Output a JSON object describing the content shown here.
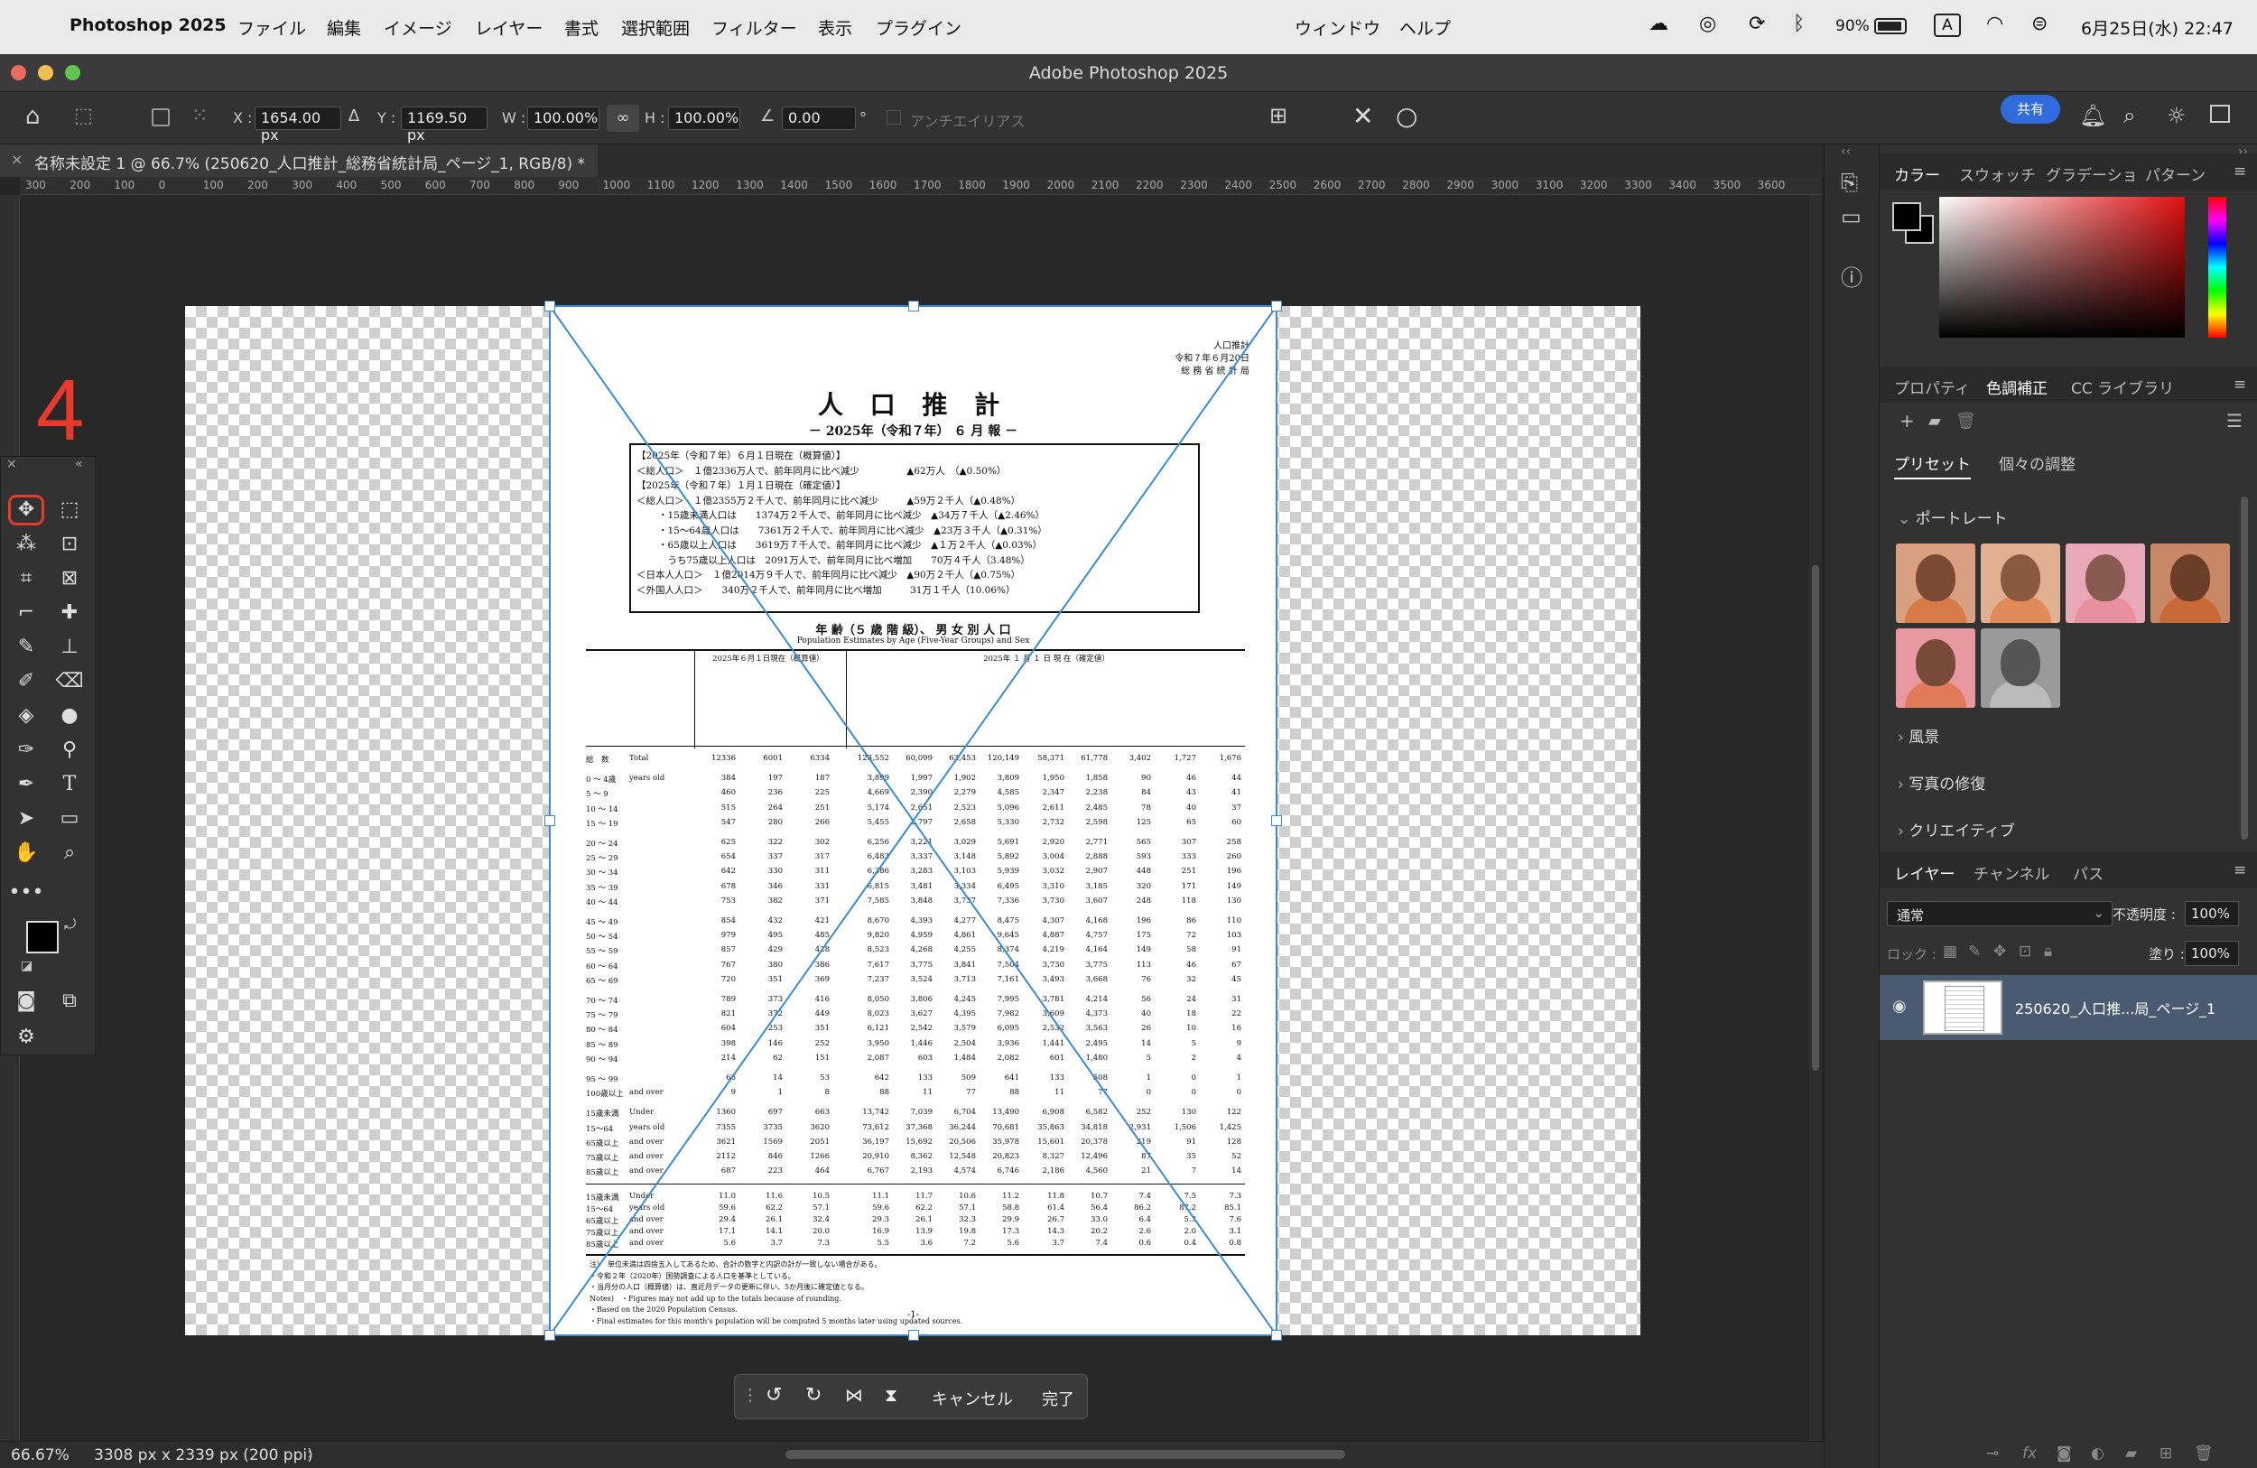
{
  "menubar": {
    "app_name": "Photoshop 2025",
    "items": [
      "ファイル",
      "編集",
      "イメージ",
      "レイヤー",
      "書式",
      "選択範囲",
      "フィルター",
      "表示",
      "プラグイン",
      "ウィンドウ",
      "ヘルプ"
    ],
    "battery": "90%",
    "input_mode": "A",
    "datetime": "6月25日(水)  22:47"
  },
  "window": {
    "title": "Adobe Photoshop 2025"
  },
  "options": {
    "x_label": "X :",
    "x_value": "1654.00 px",
    "y_label": "Y :",
    "y_value": "1169.50 px",
    "w_label": "W :",
    "w_value": "100.00%",
    "h_label": "H :",
    "h_value": "100.00%",
    "angle_value": "0.00",
    "angle_unit": "°",
    "antialias_label": "アンチエイリアス",
    "share_label": "共有"
  },
  "document_tab": {
    "title": "名称未設定 1 @ 66.7% (250620_人口推計_総務省統計局_ページ_1, RGB/8) *"
  },
  "ruler": {
    "ticks": [
      "300",
      "200",
      "100",
      "0",
      "100",
      "200",
      "300",
      "400",
      "500",
      "600",
      "700",
      "800",
      "900",
      "1000",
      "1100",
      "1200",
      "1300",
      "1400",
      "1500",
      "1600",
      "1700",
      "1800",
      "1900",
      "2000",
      "2100",
      "2200",
      "2300",
      "2400",
      "2500",
      "2600",
      "2700",
      "2800",
      "2900",
      "3000",
      "3100",
      "3200",
      "3300",
      "3400",
      "3500",
      "3600"
    ]
  },
  "annotation": {
    "step": "4"
  },
  "document": {
    "header_right": [
      "人口推計",
      "令和７年６月20日",
      "総 務 省 統 計 局"
    ],
    "title": "人 口 推 計",
    "subtitle": "－ 2025年（令和７年） ６ 月 報 －",
    "summary": [
      "【2025年（令和７年）６月１日現在（概算値）】",
      "＜総人口＞　１億2336万人で、前年同月に比べ減少　　　　　▲62万人　（▲0.50%）",
      "【2025年（令和７年）１月１日現在（確定値）】",
      "＜総人口＞　１億2355万２千人で、前年同月に比べ減少　　　▲59万２千人（▲0.48%）",
      "・15歳未満人口は　　1374万２千人で、前年同月に比べ減少　▲34万７千人（▲2.46%）",
      "・15～64歳人口は　　7361万２千人で、前年同月に比べ減少　▲23万３千人（▲0.31%）",
      "・65歳以上人口は　　3619万７千人で、前年同月に比べ減少　▲１万２千人（▲0.03%）",
      "　うち75歳以上人口は　2091万人で、前年同月に比べ増加　　70万４千人（3.48%）",
      "＜日本人人口＞　１億2014万９千人で、前年同月に比べ減少　▲90万２千人（▲0.75%）",
      "＜外国人人口＞　　340万２千人で、前年同月に比べ増加　　　31万１千人（10.06%）"
    ],
    "table_title": "年 齢（５ 歳 階 級）、 男 女 別 人 口",
    "table_subtitle": "Population Estimates by Age (Five-Year Groups) and Sex",
    "table_head_left": "2025年６月１日現在（概算値）",
    "table_head_right": "2025年 １ 月 １ 日 現 在（確定値）",
    "rows": [
      [
        "総　数",
        "Total",
        "12336",
        "6001",
        "6334",
        "123,552",
        "60,099",
        "63,453",
        "120,149",
        "58,371",
        "61,778",
        "3,402",
        "1,727",
        "1,676"
      ],
      [
        "0 ～ 4歳",
        "years old",
        "384",
        "197",
        "187",
        "3,899",
        "1,997",
        "1,902",
        "3,809",
        "1,950",
        "1,858",
        "90",
        "46",
        "44"
      ],
      [
        "5 ～ 9",
        "",
        "460",
        "236",
        "225",
        "4,669",
        "2,390",
        "2,279",
        "4,585",
        "2,347",
        "2,238",
        "84",
        "43",
        "41"
      ],
      [
        "10 ～ 14",
        "",
        "515",
        "264",
        "251",
        "5,174",
        "2,651",
        "2,523",
        "5,096",
        "2,611",
        "2,485",
        "78",
        "40",
        "37"
      ],
      [
        "15 ～ 19",
        "",
        "547",
        "280",
        "266",
        "5,455",
        "2,797",
        "2,658",
        "5,330",
        "2,732",
        "2,598",
        "125",
        "65",
        "60"
      ],
      [
        "20 ～ 24",
        "",
        "625",
        "322",
        "302",
        "6,256",
        "3,221",
        "3,029",
        "5,691",
        "2,920",
        "2,771",
        "565",
        "307",
        "258"
      ],
      [
        "25 ～ 29",
        "",
        "654",
        "337",
        "317",
        "6,483",
        "3,337",
        "3,148",
        "5,892",
        "3,004",
        "2,888",
        "593",
        "333",
        "260"
      ],
      [
        "30 ～ 34",
        "",
        "642",
        "330",
        "311",
        "6,386",
        "3,283",
        "3,103",
        "5,939",
        "3,032",
        "2,907",
        "448",
        "251",
        "196"
      ],
      [
        "35 ～ 39",
        "",
        "678",
        "346",
        "331",
        "6,815",
        "3,481",
        "3,334",
        "6,495",
        "3,310",
        "3,185",
        "320",
        "171",
        "149"
      ],
      [
        "40 ～ 44",
        "",
        "753",
        "382",
        "371",
        "7,585",
        "3,848",
        "3,737",
        "7,336",
        "3,730",
        "3,607",
        "248",
        "118",
        "130"
      ],
      [
        "45 ～ 49",
        "",
        "854",
        "432",
        "421",
        "8,670",
        "4,393",
        "4,277",
        "8,475",
        "4,307",
        "4,168",
        "196",
        "86",
        "110"
      ],
      [
        "50 ～ 54",
        "",
        "979",
        "495",
        "485",
        "9,820",
        "4,959",
        "4,861",
        "9,645",
        "4,887",
        "4,757",
        "175",
        "72",
        "103"
      ],
      [
        "55 ～ 59",
        "",
        "857",
        "429",
        "428",
        "8,523",
        "4,268",
        "4,255",
        "8,374",
        "4,219",
        "4,164",
        "149",
        "58",
        "91"
      ],
      [
        "60 ～ 64",
        "",
        "767",
        "380",
        "386",
        "7,617",
        "3,775",
        "3,841",
        "7,504",
        "3,730",
        "3,775",
        "113",
        "46",
        "67"
      ],
      [
        "65 ～ 69",
        "",
        "720",
        "351",
        "369",
        "7,237",
        "3,524",
        "3,713",
        "7,161",
        "3,493",
        "3,668",
        "76",
        "32",
        "45"
      ],
      [
        "70 ～ 74",
        "",
        "789",
        "373",
        "416",
        "8,050",
        "3,806",
        "4,245",
        "7,995",
        "3,781",
        "4,214",
        "56",
        "24",
        "31"
      ],
      [
        "75 ～ 79",
        "",
        "821",
        "372",
        "449",
        "8,023",
        "3,627",
        "4,395",
        "7,982",
        "3,609",
        "4,373",
        "40",
        "18",
        "22"
      ],
      [
        "80 ～ 84",
        "",
        "604",
        "253",
        "351",
        "6,121",
        "2,542",
        "3,579",
        "6,095",
        "2,532",
        "3,563",
        "26",
        "10",
        "16"
      ],
      [
        "85 ～ 89",
        "",
        "398",
        "146",
        "252",
        "3,950",
        "1,446",
        "2,504",
        "3,936",
        "1,441",
        "2,495",
        "14",
        "5",
        "9"
      ],
      [
        "90 ～ 94",
        "",
        "214",
        "62",
        "151",
        "2,087",
        "603",
        "1,484",
        "2,082",
        "601",
        "1,480",
        "5",
        "2",
        "4"
      ],
      [
        "95 ～ 99",
        "",
        "66",
        "14",
        "53",
        "642",
        "133",
        "509",
        "641",
        "133",
        "508",
        "1",
        "0",
        "1"
      ],
      [
        "100歳以上",
        "and over",
        "9",
        "1",
        "8",
        "88",
        "11",
        "77",
        "88",
        "11",
        "77",
        "0",
        "0",
        "0"
      ],
      [
        "15歳未満",
        "Under",
        "1360",
        "697",
        "663",
        "13,742",
        "7,039",
        "6,704",
        "13,490",
        "6,908",
        "6,582",
        "252",
        "130",
        "122"
      ],
      [
        "15～64",
        "years old",
        "7355",
        "3735",
        "3620",
        "73,612",
        "37,368",
        "36,244",
        "70,681",
        "35,863",
        "34,818",
        "2,931",
        "1,506",
        "1,425"
      ],
      [
        "65歳以上",
        "and over",
        "3621",
        "1569",
        "2051",
        "36,197",
        "15,692",
        "20,506",
        "35,978",
        "15,601",
        "20,378",
        "219",
        "91",
        "128"
      ],
      [
        "75歳以上",
        "and over",
        "2112",
        "846",
        "1266",
        "20,910",
        "8,362",
        "12,548",
        "20,823",
        "8,327",
        "12,496",
        "87",
        "35",
        "52"
      ],
      [
        "85歳以上",
        "and over",
        "687",
        "223",
        "464",
        "6,767",
        "2,193",
        "4,574",
        "6,746",
        "2,186",
        "4,560",
        "21",
        "7",
        "14"
      ]
    ],
    "pct_rows": [
      [
        "15歳未満",
        "Under",
        "11.0",
        "11.6",
        "10.5",
        "11.1",
        "11.7",
        "10.6",
        "11.2",
        "11.8",
        "10.7",
        "7.4",
        "7.5",
        "7.3"
      ],
      [
        "15～64",
        "years old",
        "59.6",
        "62.2",
        "57.1",
        "59.6",
        "62.2",
        "57.1",
        "58.8",
        "61.4",
        "56.4",
        "86.2",
        "87.2",
        "85.1"
      ],
      [
        "65歳以上",
        "and over",
        "29.4",
        "26.1",
        "32.4",
        "29.3",
        "26.1",
        "32.3",
        "29.9",
        "26.7",
        "33.0",
        "6.4",
        "5.3",
        "7.6"
      ],
      [
        "75歳以上",
        "and over",
        "17.1",
        "14.1",
        "20.0",
        "16.9",
        "13.9",
        "19.8",
        "17.3",
        "14.3",
        "20.2",
        "2.6",
        "2.0",
        "3.1"
      ],
      [
        "85歳以上",
        "and over",
        "5.6",
        "3.7",
        "7.3",
        "5.5",
        "3.6",
        "7.2",
        "5.6",
        "3.7",
        "7.4",
        "0.6",
        "0.4",
        "0.8"
      ]
    ],
    "notes": [
      "注）　単位未満は四捨五入してあるため、合計の数字と内訳の計が一致しない場合がある。",
      "・令和２年（2020年）国勢調査による人口を基準としている。",
      "・当月分の人口（概算値）は、直近月データの更新に伴い、5か月後に確定値となる。",
      "Notes)　・Figures may not add up to the totals because of rounding.",
      "・Based on the 2020 Population Census.",
      "・Final estimates for this month's population will be computed 5 months later using updated sources."
    ],
    "page_number": "-1-"
  },
  "context_bar": {
    "cancel_label": "キャンセル",
    "done_label": "完了"
  },
  "status": {
    "zoom": "66.67%",
    "doc_info": "3308 px x 2339 px (200 ppi)"
  },
  "color_panel": {
    "tabs": [
      "カラー",
      "スウォッチ",
      "グラデーショ",
      "パターン"
    ]
  },
  "adjust_panel": {
    "tabs": [
      "プロパティ",
      "色調補正",
      "CC ライブラリ"
    ],
    "subtabs": [
      "プリセット",
      "個々の調整"
    ],
    "groups": [
      "ポートレート",
      "風景",
      "写真の修復",
      "クリエイティブ"
    ]
  },
  "layers_panel": {
    "tabs": [
      "レイヤー",
      "チャンネル",
      "パス"
    ],
    "blend_mode": "通常",
    "opacity_label": "不透明度 :",
    "opacity_value": "100%",
    "lock_label": "ロック :",
    "fill_label": "塗り :",
    "fill_value": "100%",
    "layer_name": "250620_人口推...局_ページ_1"
  },
  "colors": {
    "accent": "#2f6bdb",
    "annotation": "#e8392b",
    "transform_line": "#3a8ad8"
  }
}
